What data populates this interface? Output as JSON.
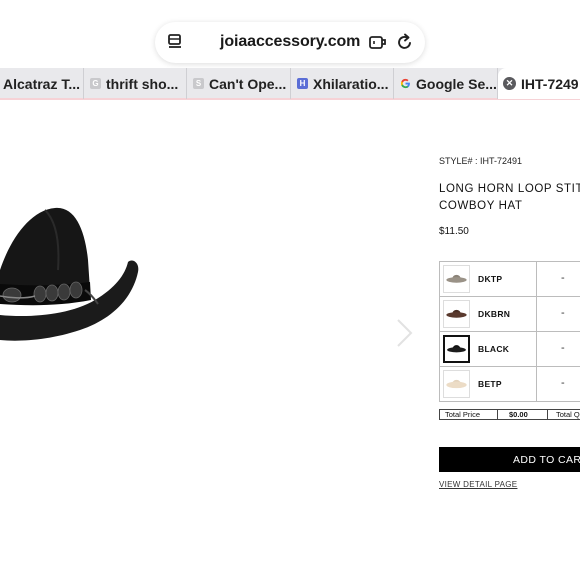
{
  "browser": {
    "url": "joiaaccessory.com",
    "tabs": [
      {
        "label": "Alcatraz T..."
      },
      {
        "label": "thrift sho..."
      },
      {
        "label": "Can't Ope..."
      },
      {
        "label": "Xhilaratio..."
      },
      {
        "label": "Google Se..."
      },
      {
        "label": "IHT-7249"
      }
    ]
  },
  "product": {
    "style_line": "STYLE# : IHT-72491",
    "title_line1": "LONG HORN LOOP STITC",
    "title_line2": "COWBOY HAT",
    "price": "$11.50",
    "colors": [
      {
        "code": "DKTP",
        "qty": "-",
        "swatch": "#8b8378"
      },
      {
        "code": "DKBRN",
        "qty": "-",
        "swatch": "#4a2f25"
      },
      {
        "code": "BLACK",
        "qty": "-",
        "swatch": "#111111"
      },
      {
        "code": "BETP",
        "qty": "-",
        "swatch": "#e3d3bd"
      }
    ],
    "total_price_label": "Total Price",
    "total_price_value": "$0.00",
    "total_qty_label": "Total Q",
    "add_to_cart": "ADD TO CART",
    "view_detail": "VIEW DETAIL PAGE"
  }
}
